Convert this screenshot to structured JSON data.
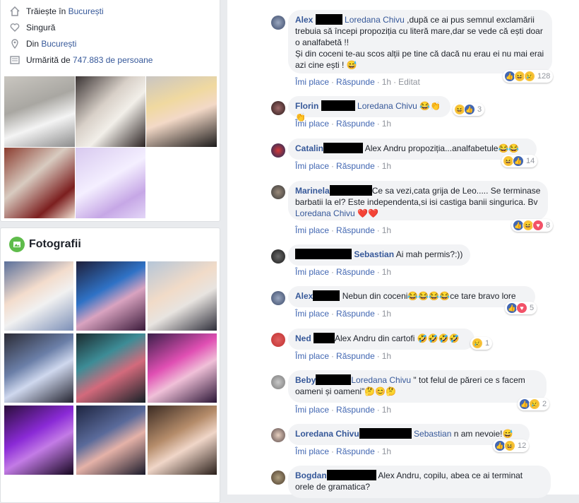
{
  "intro": {
    "lives_prefix": "Trăiește în",
    "lives_city": "București",
    "relationship": "Singură",
    "from_prefix": "Din",
    "from_city": "București",
    "followers_prefix": "Urmărită de",
    "followers_link": "747.883 de persoane"
  },
  "photos": {
    "title": "Fotografii"
  },
  "labels": {
    "like": "Îmi place",
    "reply": "Răspunde",
    "edited": "Editat"
  },
  "comments": [
    {
      "author": "Alex",
      "tag": "Loredana Chivu",
      "text": " ,după ce ai pus semnul exclamării trebuia să începi propoziția cu literă mare,dar se vede că ești doar o analfabetă !!",
      "text2": "Și din coceni te-au scos alții pe tine că dacă nu erau ei nu mai erai azi cine ești ! 😅",
      "time": "1h",
      "edited": true,
      "reactions": "128"
    },
    {
      "author": "Florin",
      "tag": "Loredana Chivu",
      "text": " 😂👏👏",
      "time": "1h",
      "reactions": "3"
    },
    {
      "author": "Catalin",
      "tag": "",
      "text": "Alex Andru propoziția...analfabetule😂😂",
      "time": "1h",
      "reactions": "14"
    },
    {
      "author": "Marinela",
      "tag": "Loredana Chivu",
      "text": "Ce sa vezi,cata grija de Leo..... Se terminase barbatii la el? Este independenta,si isi castiga banii singurica. Bv ",
      "text_after": " ❤️❤️",
      "time": "1h",
      "reactions": "8"
    },
    {
      "author": "Sebastian",
      "tag": "",
      "text": " Ai mah permis?:))",
      "time": "1h",
      "reactions": ""
    },
    {
      "author": "Alex",
      "tag": "",
      "text": "Nebun din coceni😂😂😂😂ce tare bravo lore",
      "time": "1h",
      "reactions": "5"
    },
    {
      "author": "Ned",
      "tag": "",
      "text": "Alex Andru din cartofi 🤣🤣🤣🤣",
      "time": "1h",
      "reactions": "1"
    },
    {
      "author": "Beby",
      "tag": "Loredana Chivu",
      "text": " \" tot felul de păreri ce s facem oameni și oameni\"🤔😊🤔",
      "time": "1h",
      "reactions": "2"
    },
    {
      "author": "Loredana Chivu",
      "tag": "Sebastian",
      "text": " n am nevoie!😅",
      "time": "1h",
      "reactions": "12"
    },
    {
      "author": "Bogdan",
      "tag": "",
      "text": "Alex Andru, copilu, abea ce ai terminat orele de gramatica?",
      "time": "",
      "reactions": ""
    }
  ]
}
